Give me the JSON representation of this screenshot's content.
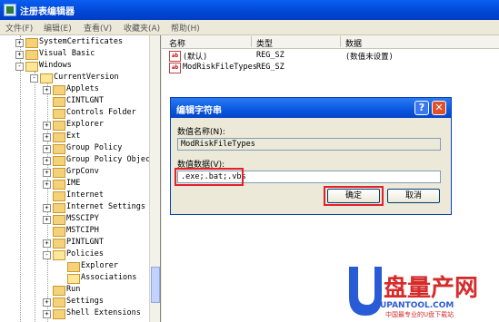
{
  "window": {
    "title": "注册表编辑器"
  },
  "menu": [
    "文件(F)",
    "编辑(E)",
    "查看(V)",
    "收藏夹(A)",
    "帮助(H)"
  ],
  "tree": [
    {
      "label": "SystemCertificates",
      "exp": "+"
    },
    {
      "label": "Visual Basic",
      "exp": "+"
    },
    {
      "label": "Windows",
      "exp": "-"
    },
    {
      "label": "CurrentVersion",
      "exp": "-"
    },
    {
      "label": "Applets",
      "exp": "+"
    },
    {
      "label": "CINTLGNT",
      "exp": ""
    },
    {
      "label": "Controls Folder",
      "exp": ""
    },
    {
      "label": "Explorer",
      "exp": "+"
    },
    {
      "label": "Ext",
      "exp": "+"
    },
    {
      "label": "Group Policy",
      "exp": "+"
    },
    {
      "label": "Group Policy Objec",
      "exp": "+"
    },
    {
      "label": "GrpConv",
      "exp": "+"
    },
    {
      "label": "IME",
      "exp": "+"
    },
    {
      "label": "Internet",
      "exp": ""
    },
    {
      "label": "Internet Settings",
      "exp": "+"
    },
    {
      "label": "MSSCIPY",
      "exp": "+"
    },
    {
      "label": "MSTCIPH",
      "exp": ""
    },
    {
      "label": "PINTLGNT",
      "exp": "+"
    },
    {
      "label": "Policies",
      "exp": "-"
    },
    {
      "label": "Explorer",
      "exp": ""
    },
    {
      "label": "Associations",
      "exp": ""
    },
    {
      "label": "Run",
      "exp": ""
    },
    {
      "label": "Settings",
      "exp": "+"
    },
    {
      "label": "Shell Extensions",
      "exp": "+"
    }
  ],
  "list": {
    "headers": [
      "名称",
      "类型",
      "数据"
    ],
    "rows": [
      {
        "name": "(默认)",
        "type": "REG_SZ",
        "data": "(数值未设置)",
        "icon": "ab"
      },
      {
        "name": "ModRiskFileTypes",
        "type": "REG_SZ",
        "data": "",
        "icon": "ab"
      }
    ]
  },
  "dialog": {
    "title": "编辑字符串",
    "help": "?",
    "close": "✕",
    "name_label": "数值名称(N):",
    "name_value": "ModRiskFileTypes",
    "data_label": "数值数据(V):",
    "data_value": ".exe;.bat;.vbs",
    "ok": "确定",
    "cancel": "取消"
  },
  "watermark": {
    "text": "盘量产网",
    "url": "UPANTOOL.COM",
    "slogan": "中国最专业的U盘下载站"
  },
  "colors": {
    "titlebar": "#0046d5",
    "highlight": "#e3212b",
    "watermark_blue": "#2a5bd7",
    "watermark_red": "#d62b2b"
  }
}
